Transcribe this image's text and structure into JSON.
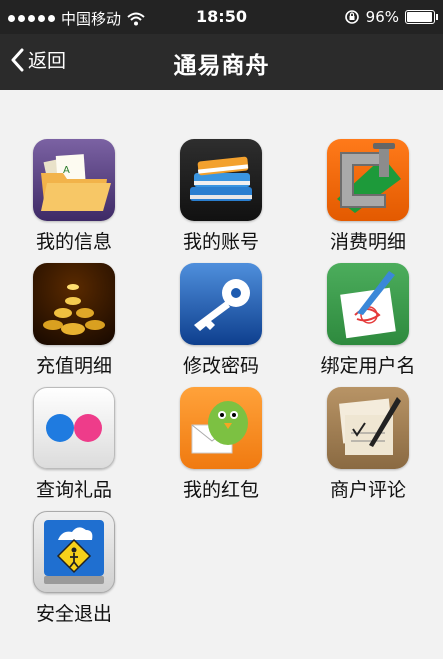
{
  "status": {
    "carrier": "中国移动",
    "time": "18:50",
    "battery": "96%",
    "battery_level": 0.96
  },
  "nav": {
    "back_label": "返回",
    "title": "通易商舟"
  },
  "menu": [
    {
      "label": "我的信息",
      "icon": "folder-icon"
    },
    {
      "label": "我的账号",
      "icon": "books-icon"
    },
    {
      "label": "消费明细",
      "icon": "clamp-icon"
    },
    {
      "label": "充值明细",
      "icon": "coins-icon"
    },
    {
      "label": "修改密码",
      "icon": "key-icon"
    },
    {
      "label": "绑定用户名",
      "icon": "paper-pen-icon"
    },
    {
      "label": "查询礼品",
      "icon": "flickr-dots-icon"
    },
    {
      "label": "我的红包",
      "icon": "bird-envelope-icon"
    },
    {
      "label": "商户评论",
      "icon": "notepad-pen-icon"
    },
    {
      "label": "安全退出",
      "icon": "secure-drive-icon"
    }
  ]
}
